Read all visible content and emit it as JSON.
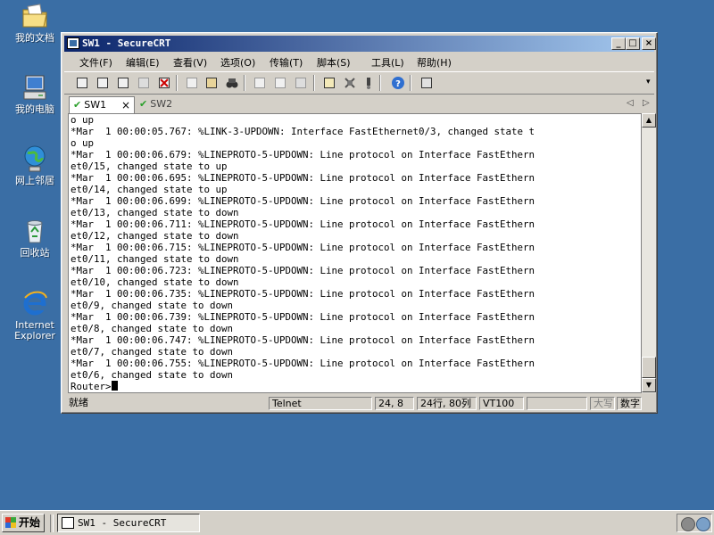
{
  "desktop": {
    "icons": [
      {
        "label": "我的文档"
      },
      {
        "label": "我的电脑"
      },
      {
        "label": "网上邻居"
      },
      {
        "label": "回收站"
      },
      {
        "label": "Internet\nExplorer"
      }
    ]
  },
  "window": {
    "title": "SW1 - SecureCRT",
    "buttons": {
      "minimize": "_",
      "maximize": "□",
      "close": "×"
    },
    "menu": [
      "文件(F)",
      "编辑(E)",
      "查看(V)",
      "选项(O)",
      "传输(T)",
      "脚本(S)",
      "工具(L)",
      "帮助(H)"
    ],
    "tabs": [
      {
        "label": "SW1",
        "active": true,
        "close": "×"
      },
      {
        "label": "SW2",
        "active": false
      }
    ],
    "terminal_lines": [
      "o up",
      "*Mar  1 00:00:05.767: %LINK-3-UPDOWN: Interface FastEthernet0/3, changed state t",
      "o up",
      "*Mar  1 00:00:06.679: %LINEPROTO-5-UPDOWN: Line protocol on Interface FastEthern",
      "et0/15, changed state to up",
      "*Mar  1 00:00:06.695: %LINEPROTO-5-UPDOWN: Line protocol on Interface FastEthern",
      "et0/14, changed state to up",
      "*Mar  1 00:00:06.699: %LINEPROTO-5-UPDOWN: Line protocol on Interface FastEthern",
      "et0/13, changed state to down",
      "*Mar  1 00:00:06.711: %LINEPROTO-5-UPDOWN: Line protocol on Interface FastEthern",
      "et0/12, changed state to down",
      "*Mar  1 00:00:06.715: %LINEPROTO-5-UPDOWN: Line protocol on Interface FastEthern",
      "et0/11, changed state to down",
      "*Mar  1 00:00:06.723: %LINEPROTO-5-UPDOWN: Line protocol on Interface FastEthern",
      "et0/10, changed state to down",
      "*Mar  1 00:00:06.735: %LINEPROTO-5-UPDOWN: Line protocol on Interface FastEthern",
      "et0/9, changed state to down",
      "*Mar  1 00:00:06.739: %LINEPROTO-5-UPDOWN: Line protocol on Interface FastEthern",
      "et0/8, changed state to down",
      "*Mar  1 00:00:06.747: %LINEPROTO-5-UPDOWN: Line protocol on Interface FastEthern",
      "et0/7, changed state to down",
      "*Mar  1 00:00:06.755: %LINEPROTO-5-UPDOWN: Line protocol on Interface FastEthern",
      "et0/6, changed state to down"
    ],
    "prompt": "Router>",
    "status": {
      "ready": "就绪",
      "protocol": "Telnet",
      "cursor_pos": "24,  8",
      "size": "24行, 80列",
      "emulation": "VT100",
      "caps": "大写",
      "num": "数字"
    }
  },
  "taskbar": {
    "start_label": "开始",
    "task_label": "SW1 - SecureCRT"
  },
  "colors": {
    "desktop": "#3a6ea5",
    "title_active_start": "#0a246a",
    "title_active_end": "#a6caf0",
    "tab_check": "#2aa02a"
  }
}
